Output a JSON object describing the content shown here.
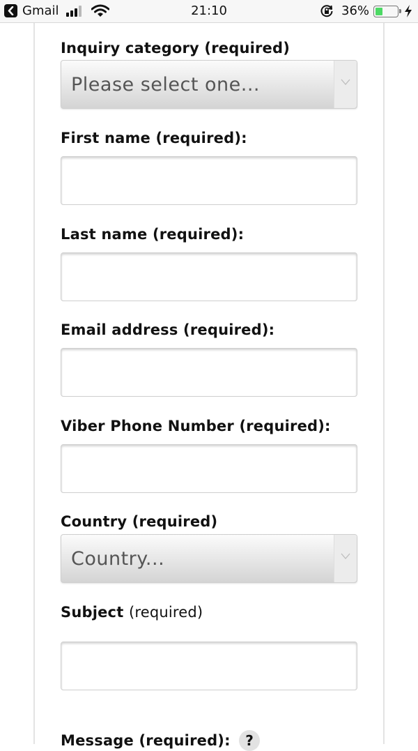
{
  "status_bar": {
    "back_app": "Gmail",
    "time": "21:10",
    "battery_percent": "36%",
    "battery_level": 0.36,
    "signal_bars": 3,
    "icons": [
      "back-arrow-icon",
      "signal-icon",
      "wifi-icon",
      "orientation-lock-icon",
      "battery-icon",
      "charging-bolt-icon"
    ]
  },
  "form": {
    "inquiry_category": {
      "label": "Inquiry category (required)",
      "selected": "Please select one..."
    },
    "first_name": {
      "label": "First name (required):",
      "value": ""
    },
    "last_name": {
      "label": "Last name (required):",
      "value": ""
    },
    "email": {
      "label": "Email address (required):",
      "value": ""
    },
    "viber_phone": {
      "label": "Viber Phone Number (required):",
      "value": ""
    },
    "country": {
      "label": "Country (required)",
      "selected": "Country..."
    },
    "subject": {
      "label_bold": "Subject",
      "label_note": "(required)",
      "value": ""
    },
    "message": {
      "label": "Message (required):",
      "help": "?"
    }
  },
  "colors": {
    "battery_fill": "#4cd964",
    "select_gradient_top": "#fbfbfb",
    "select_gradient_bottom": "#d4d4d4",
    "text": "#111111"
  }
}
